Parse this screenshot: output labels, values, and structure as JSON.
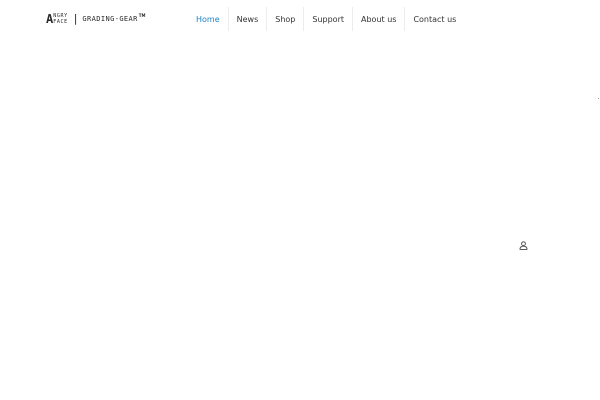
{
  "logo": {
    "letter": "A",
    "line_top": "NGRY",
    "line_bottom": "FACE",
    "separator": "|",
    "brand": "GRADING-GEAR",
    "trademark": "TM"
  },
  "nav": {
    "items": [
      {
        "label": "Home",
        "active": true
      },
      {
        "label": "News",
        "active": false
      },
      {
        "label": "Shop",
        "active": false
      },
      {
        "label": "Support",
        "active": false
      },
      {
        "label": "About us",
        "active": false
      },
      {
        "label": "Contact us",
        "active": false
      }
    ]
  },
  "colors": {
    "accent": "#1b84c6",
    "text": "#333333",
    "divider": "#ececec"
  },
  "icons": {
    "account": "user-icon"
  }
}
